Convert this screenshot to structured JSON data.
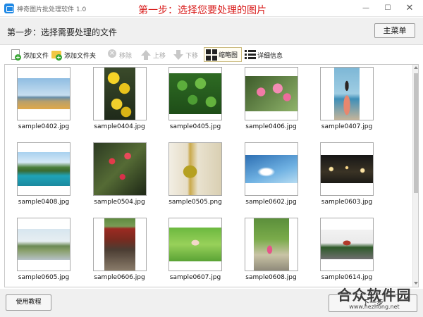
{
  "window": {
    "app_title": "神奇图片批处理软件 1.0",
    "step_banner": "第一步：选择您要处理的图片",
    "minimize_glyph": "—",
    "maximize_glyph": "☐",
    "close_glyph": "✕"
  },
  "header": {
    "title": "第一步：选择需要处理的文件",
    "main_menu_label": "主菜单"
  },
  "toolbar": {
    "add_file": "添加文件",
    "add_folder": "添加文件夹",
    "remove": "移除",
    "move_up": "上移",
    "move_down": "下移",
    "thumbnail_view": "缩略图",
    "detail_view": "详细信息"
  },
  "thumbnails": [
    {
      "filename": "sample0402.jpg",
      "scene": "coast-landscape"
    },
    {
      "filename": "sample0404.jpg",
      "scene": "yellow-ginkgo-leaves"
    },
    {
      "filename": "sample0405.jpg",
      "scene": "green-clover"
    },
    {
      "filename": "sample0406.jpg",
      "scene": "pink-blossoms"
    },
    {
      "filename": "sample0407.jpg",
      "scene": "woman-at-sea"
    },
    {
      "filename": "sample0408.jpg",
      "scene": "mountain-lake"
    },
    {
      "filename": "sample0504.jpg",
      "scene": "red-berries"
    },
    {
      "filename": "sample0505.png",
      "scene": "glass-bottles"
    },
    {
      "filename": "sample0602.jpg",
      "scene": "blue-sky-clouds"
    },
    {
      "filename": "sample0603.jpg",
      "scene": "city-night-lights"
    },
    {
      "filename": "sample0605.jpg",
      "scene": "lakeside-park"
    },
    {
      "filename": "sample0606.jpg",
      "scene": "red-gate-alley"
    },
    {
      "filename": "sample0607.jpg",
      "scene": "girl-in-field"
    },
    {
      "filename": "sample0608.jpg",
      "scene": "woman-under-tree"
    },
    {
      "filename": "sample0614.jpg",
      "scene": "chinese-pavilion"
    }
  ],
  "footer": {
    "tutorial_label": "使用教程",
    "next_label": "下一步"
  },
  "watermark": {
    "logo_text": "合众软件园",
    "url": "www.hezhong.net"
  },
  "colors": {
    "banner_red": "#d9201f",
    "chrome_gray": "#f0f0f0",
    "active_view_bg": "#fffdf2"
  }
}
